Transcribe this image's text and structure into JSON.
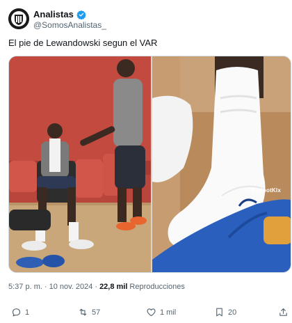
{
  "author": {
    "display_name": "Analistas",
    "handle": "@SomosAnalistas_",
    "verified_icon": "verified-badge-icon"
  },
  "tweet": {
    "text": "El pie de Lewandowski segun el VAR"
  },
  "media": {
    "watermark": "@BigfootKlx"
  },
  "meta": {
    "time": "5:37 p. m.",
    "separator": "·",
    "date": "10 nov. 2024",
    "views_count": "22,8 mil",
    "views_label": "Reproducciones"
  },
  "actions": {
    "reply_count": "1",
    "retweet_count": "57",
    "like_count": "1 mil",
    "bookmark_count": "20"
  },
  "colors": {
    "text_primary": "#0f1419",
    "text_secondary": "#536471",
    "verified_blue": "#1d9bf0"
  }
}
